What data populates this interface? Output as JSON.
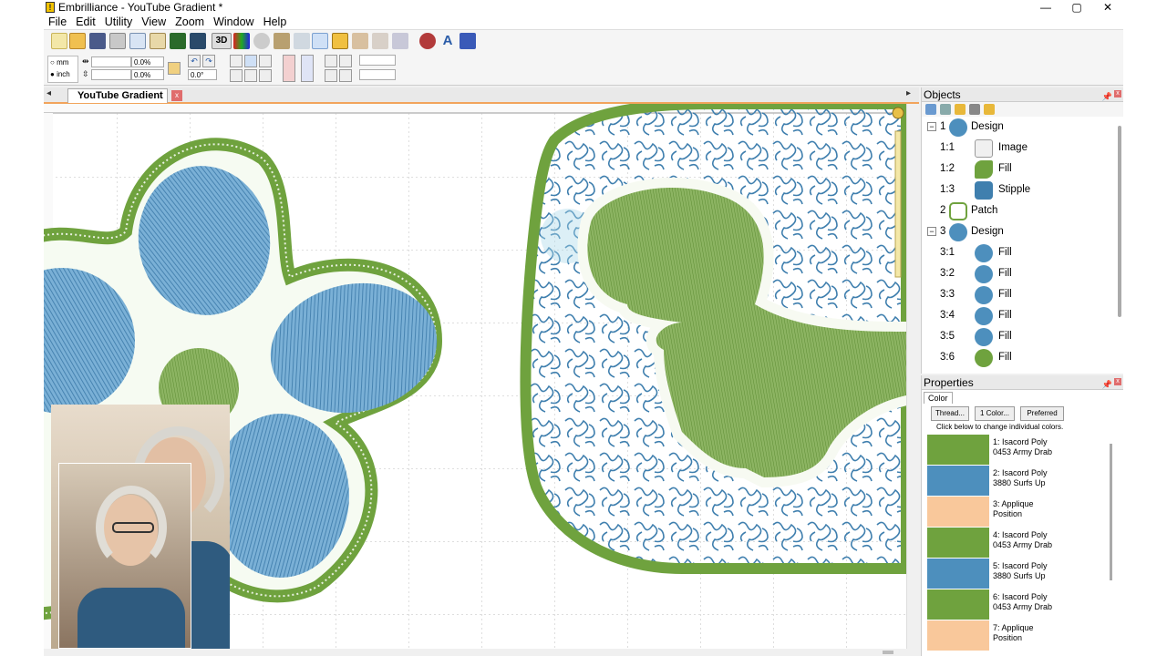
{
  "window": {
    "title": "Embrilliance -  YouTube Gradient *",
    "controls": [
      "—",
      "▢",
      "✕"
    ]
  },
  "menu": [
    "File",
    "Edit",
    "Utility",
    "View",
    "Zoom",
    "Window",
    "Help"
  ],
  "toolbar2": {
    "unit_mm": "mm",
    "unit_inch": "inch",
    "scale_x": "0.0%",
    "scale_y": "0.0%",
    "rotation": "0.0°"
  },
  "document_tab": {
    "label": "YouTube Gradient *",
    "close": "x"
  },
  "objects_panel": {
    "title": "Objects",
    "items": [
      {
        "num": "1",
        "label": "Design",
        "level": 0,
        "expanded": "−"
      },
      {
        "num": "1:1",
        "label": "Image",
        "level": 1
      },
      {
        "num": "1:2",
        "label": "Fill",
        "level": 1
      },
      {
        "num": "1:3",
        "label": "Stipple",
        "level": 1
      },
      {
        "num": "2",
        "label": "Patch",
        "level": 0
      },
      {
        "num": "3",
        "label": "Design",
        "level": 0,
        "expanded": "−"
      },
      {
        "num": "3:1",
        "label": "Fill",
        "level": 1
      },
      {
        "num": "3:2",
        "label": "Fill",
        "level": 1
      },
      {
        "num": "3:3",
        "label": "Fill",
        "level": 1
      },
      {
        "num": "3:4",
        "label": "Fill",
        "level": 1
      },
      {
        "num": "3:5",
        "label": "Fill",
        "level": 1
      },
      {
        "num": "3:6",
        "label": "Fill",
        "level": 1
      }
    ]
  },
  "properties_panel": {
    "title": "Properties",
    "tab": "Color",
    "buttons": [
      "Thread...",
      "1 Color...",
      "Preferred"
    ],
    "hint": "Click below to change individual colors.",
    "colors": [
      {
        "line1": "1: Isacord Poly",
        "line2": "0453 Army Drab",
        "hex": "#6fa23e"
      },
      {
        "line1": "2: Isacord Poly",
        "line2": "3880 Surfs Up",
        "hex": "#4d8fbd"
      },
      {
        "line1": "3: Applique",
        "line2": "Position",
        "hex": "#f9c89b"
      },
      {
        "line1": "4: Isacord Poly",
        "line2": "0453 Army Drab",
        "hex": "#6fa23e"
      },
      {
        "line1": "5: Isacord Poly",
        "line2": "3880 Surfs Up",
        "hex": "#4d8fbd"
      },
      {
        "line1": "6: Isacord Poly",
        "line2": "0453 Army Drab",
        "hex": "#6fa23e"
      },
      {
        "line1": "7: Applique",
        "line2": "Position",
        "hex": "#f9c89b"
      }
    ]
  },
  "colors": {
    "green": "#6fa23e",
    "blue": "#4d8fbd",
    "tab_accent": "#f2a45c"
  }
}
